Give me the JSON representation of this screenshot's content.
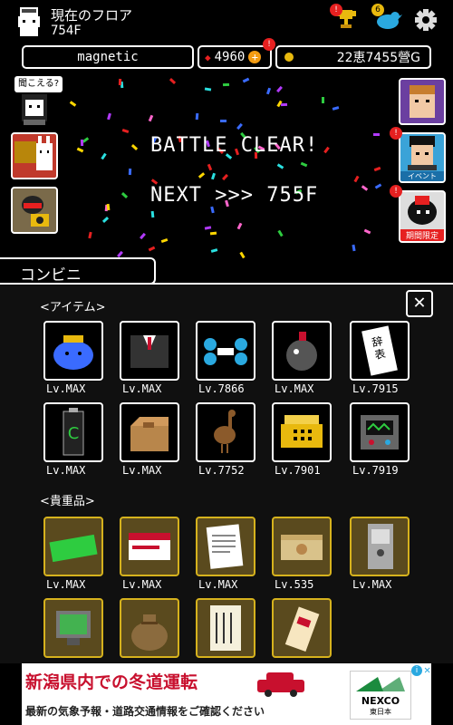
{
  "header": {
    "floor_label": "現在のフロア",
    "floor_value": "754F",
    "player_name": "magnetic",
    "gems": "4960",
    "gold": "22恵7455營G",
    "trophy_badge": "!",
    "bird_badge": "6",
    "gems_badge": "!"
  },
  "left_side": {
    "speech": "聞こえる?"
  },
  "right_side": {
    "event_label": "イベント",
    "limited_label": "期間限定"
  },
  "battle": {
    "clear_text": "BATTLE CLEAR!",
    "next_text": "NEXT >>> 755F"
  },
  "shop": {
    "title": "コンビニ",
    "close": "✕",
    "items_label": "<アイテム>",
    "valuables_label": "<貴重品>",
    "items": [
      {
        "name": "blue-bag",
        "level": "Lv.MAX"
      },
      {
        "name": "suit",
        "level": "Lv.MAX"
      },
      {
        "name": "drone",
        "level": "Lv.7866"
      },
      {
        "name": "bomb",
        "level": "Lv.MAX"
      },
      {
        "name": "resignation-letter",
        "level": "Lv.7915"
      },
      {
        "name": "battery",
        "level": "Lv.MAX"
      },
      {
        "name": "box",
        "level": "Lv.MAX"
      },
      {
        "name": "bird",
        "level": "Lv.7752"
      },
      {
        "name": "phone",
        "level": "Lv.7901"
      },
      {
        "name": "robot",
        "level": "Lv.7919"
      }
    ],
    "valuables": [
      {
        "name": "keyboard",
        "level": "Lv.MAX"
      },
      {
        "name": "card",
        "level": "Lv.MAX"
      },
      {
        "name": "document",
        "level": "Lv.MAX"
      },
      {
        "name": "money",
        "level": "Lv.535"
      },
      {
        "name": "device",
        "level": "Lv.MAX"
      },
      {
        "name": "monitor",
        "level": ""
      },
      {
        "name": "sack",
        "level": ""
      },
      {
        "name": "scroll",
        "level": ""
      },
      {
        "name": "charm",
        "level": ""
      }
    ],
    "letter_text": "辞表"
  },
  "ad": {
    "title": "新潟県内での冬道運転",
    "subtitle": "最新の気象予報・道路交通情報をご確認ください",
    "brand": "NEXCO",
    "brand_sub": "東日本"
  },
  "colors": {
    "background": "#000000",
    "shop_bg": "#101010",
    "gold_border": "#d6b21d",
    "badge_red": "#e62020",
    "ad_red": "#c8102e"
  }
}
